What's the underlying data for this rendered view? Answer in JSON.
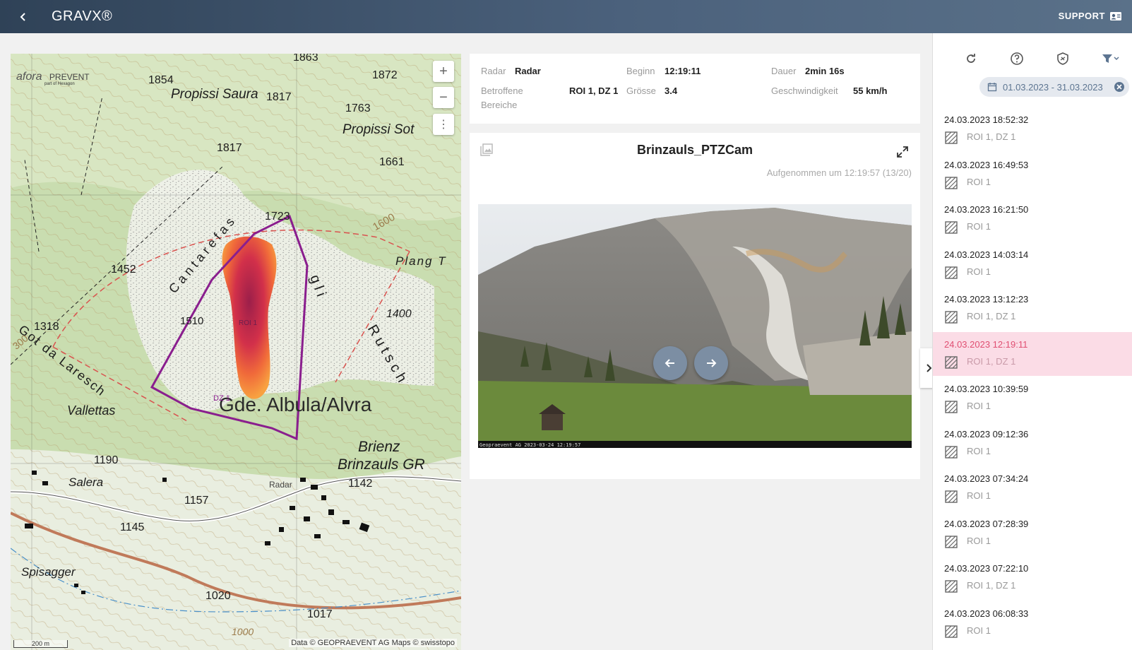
{
  "header": {
    "title": "GRAVX®",
    "support_label": "SUPPORT",
    "back_icon": "back-arrow-icon"
  },
  "map": {
    "zoom_in": "+",
    "zoom_out": "−",
    "more": "⋮",
    "logo_text": "afora",
    "logo_brand": "PREVENT",
    "logo_sub": "part of Hexagon",
    "attribution": "Data © GEOPRAEVENT AG Maps © swisstopo",
    "scale_label": "200 m",
    "labels": {
      "propissi_saura": "Propissi Saura",
      "propissi_sot": "Propissi Sot",
      "plang": "Plang T",
      "got_da_laresch": "Got da Laresch",
      "vallettas": "Vallettas",
      "albula": "Gde. Albula/Alvra",
      "brienz": "Brienz",
      "brinzauls": "Brinzauls GR",
      "salera": "Salera",
      "spisagger": "Spisagger",
      "radar": "Radar",
      "roi": "ROI 1",
      "dz": "DZ 1",
      "e1863": "1863",
      "e1854": "1854",
      "e1872": "1872",
      "e1817a": "1817",
      "e1763": "1763",
      "e1817b": "1817",
      "e1661": "1661",
      "e1723": "1723",
      "e1600": "1600",
      "e1452": "1452",
      "e1400": "1400",
      "e1510": "1510",
      "e1318": "1318",
      "e300": "300",
      "e1190": "1190",
      "e1142": "1142",
      "e1157": "1157",
      "e1145": "1145",
      "e1020": "1020",
      "e1017": "1017",
      "e1000": "1000",
      "cantanias": "C a n t a r e f a s",
      "gli": "g l i",
      "rutsch": "R u t s c h"
    }
  },
  "event_info": {
    "radar_label": "Radar",
    "radar_value": "Radar",
    "beginn_label": "Beginn",
    "beginn_value": "12:19:11",
    "dauer_label": "Dauer",
    "dauer_value": "2min 16s",
    "bereiche_label_1": "Betroffene",
    "bereiche_label_2": "Bereiche",
    "bereiche_value": "ROI 1, DZ 1",
    "groesse_label": "Grösse",
    "groesse_value": "3.4",
    "geschw_label": "Geschwindigkeit",
    "geschw_value": "55 km/h"
  },
  "camera": {
    "title": "Brinzauls_PTZCam",
    "subtitle": "Aufgenommen um 12:19:57 (13/20)",
    "image_stamp": "Geopraevent AG 2023-03-24 12:19:57"
  },
  "sidebar": {
    "date_range": "01.03.2023 - 31.03.2023",
    "events": [
      {
        "time": "24.03.2023 18:52:32",
        "zones": "ROI 1, DZ 1"
      },
      {
        "time": "24.03.2023 16:49:53",
        "zones": "ROI 1"
      },
      {
        "time": "24.03.2023 16:21:50",
        "zones": "ROI 1"
      },
      {
        "time": "24.03.2023 14:03:14",
        "zones": "ROI 1"
      },
      {
        "time": "24.03.2023 13:12:23",
        "zones": "ROI 1, DZ 1"
      },
      {
        "time": "24.03.2023 12:19:11",
        "zones": "ROI 1, DZ 1",
        "selected": true
      },
      {
        "time": "24.03.2023 10:39:59",
        "zones": "ROI 1"
      },
      {
        "time": "24.03.2023 09:12:36",
        "zones": "ROI 1"
      },
      {
        "time": "24.03.2023 07:34:24",
        "zones": "ROI 1"
      },
      {
        "time": "24.03.2023 07:28:39",
        "zones": "ROI 1"
      },
      {
        "time": "24.03.2023 07:22:10",
        "zones": "ROI 1, DZ 1"
      },
      {
        "time": "24.03.2023 06:08:33",
        "zones": "ROI 1"
      }
    ]
  },
  "colors": {
    "accent": "#e04f72",
    "selected_bg": "#fbdce6",
    "chip_bg": "#e5e9ef",
    "nav_button": "#7c8ea3",
    "roi_outline": "#8a1e8e"
  }
}
